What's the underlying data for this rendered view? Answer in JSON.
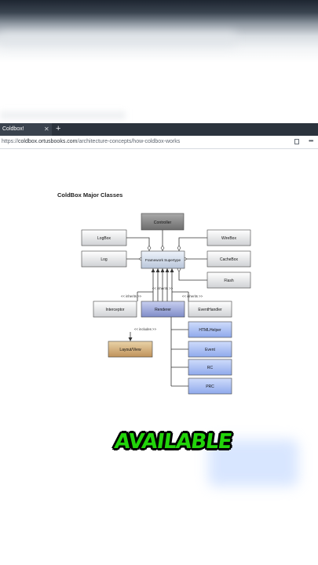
{
  "browser": {
    "tab_title": "Coldbox!",
    "tab_close": "✕",
    "new_tab": "+",
    "url_prefix": "https://",
    "url_host": "coldbox.ortusbooks.com",
    "url_path": "/architecture-concepts/how-coldbox-works",
    "more": "•••"
  },
  "diagram": {
    "title": "ColdBox Major Classes",
    "boxes": {
      "controller": "Controller",
      "logbox": "LogBox",
      "log": "Log",
      "framework_supertype": "Framework Supertype",
      "wirebox": "WireBox",
      "cachebox": "CacheBox",
      "flash": "Flash",
      "interceptor": "Interceptor",
      "renderer": "Renderer",
      "eventhandler": "EventHandler",
      "layoutview": "Layout/View",
      "htmlhelper": "HTMLHelper",
      "event": "Event",
      "rc": "RC",
      "prc": "PRC"
    },
    "labels": {
      "inherits_center": "<< inherits >>",
      "inherits_left": "<< inherits >>",
      "inherits_right": "<< inherits >>",
      "includes": "<< includes >>"
    }
  },
  "overlay": {
    "caption": "AVAILABLE"
  },
  "colors": {
    "caption_green": "#22d40a",
    "tab_bar": "#2b333d"
  }
}
